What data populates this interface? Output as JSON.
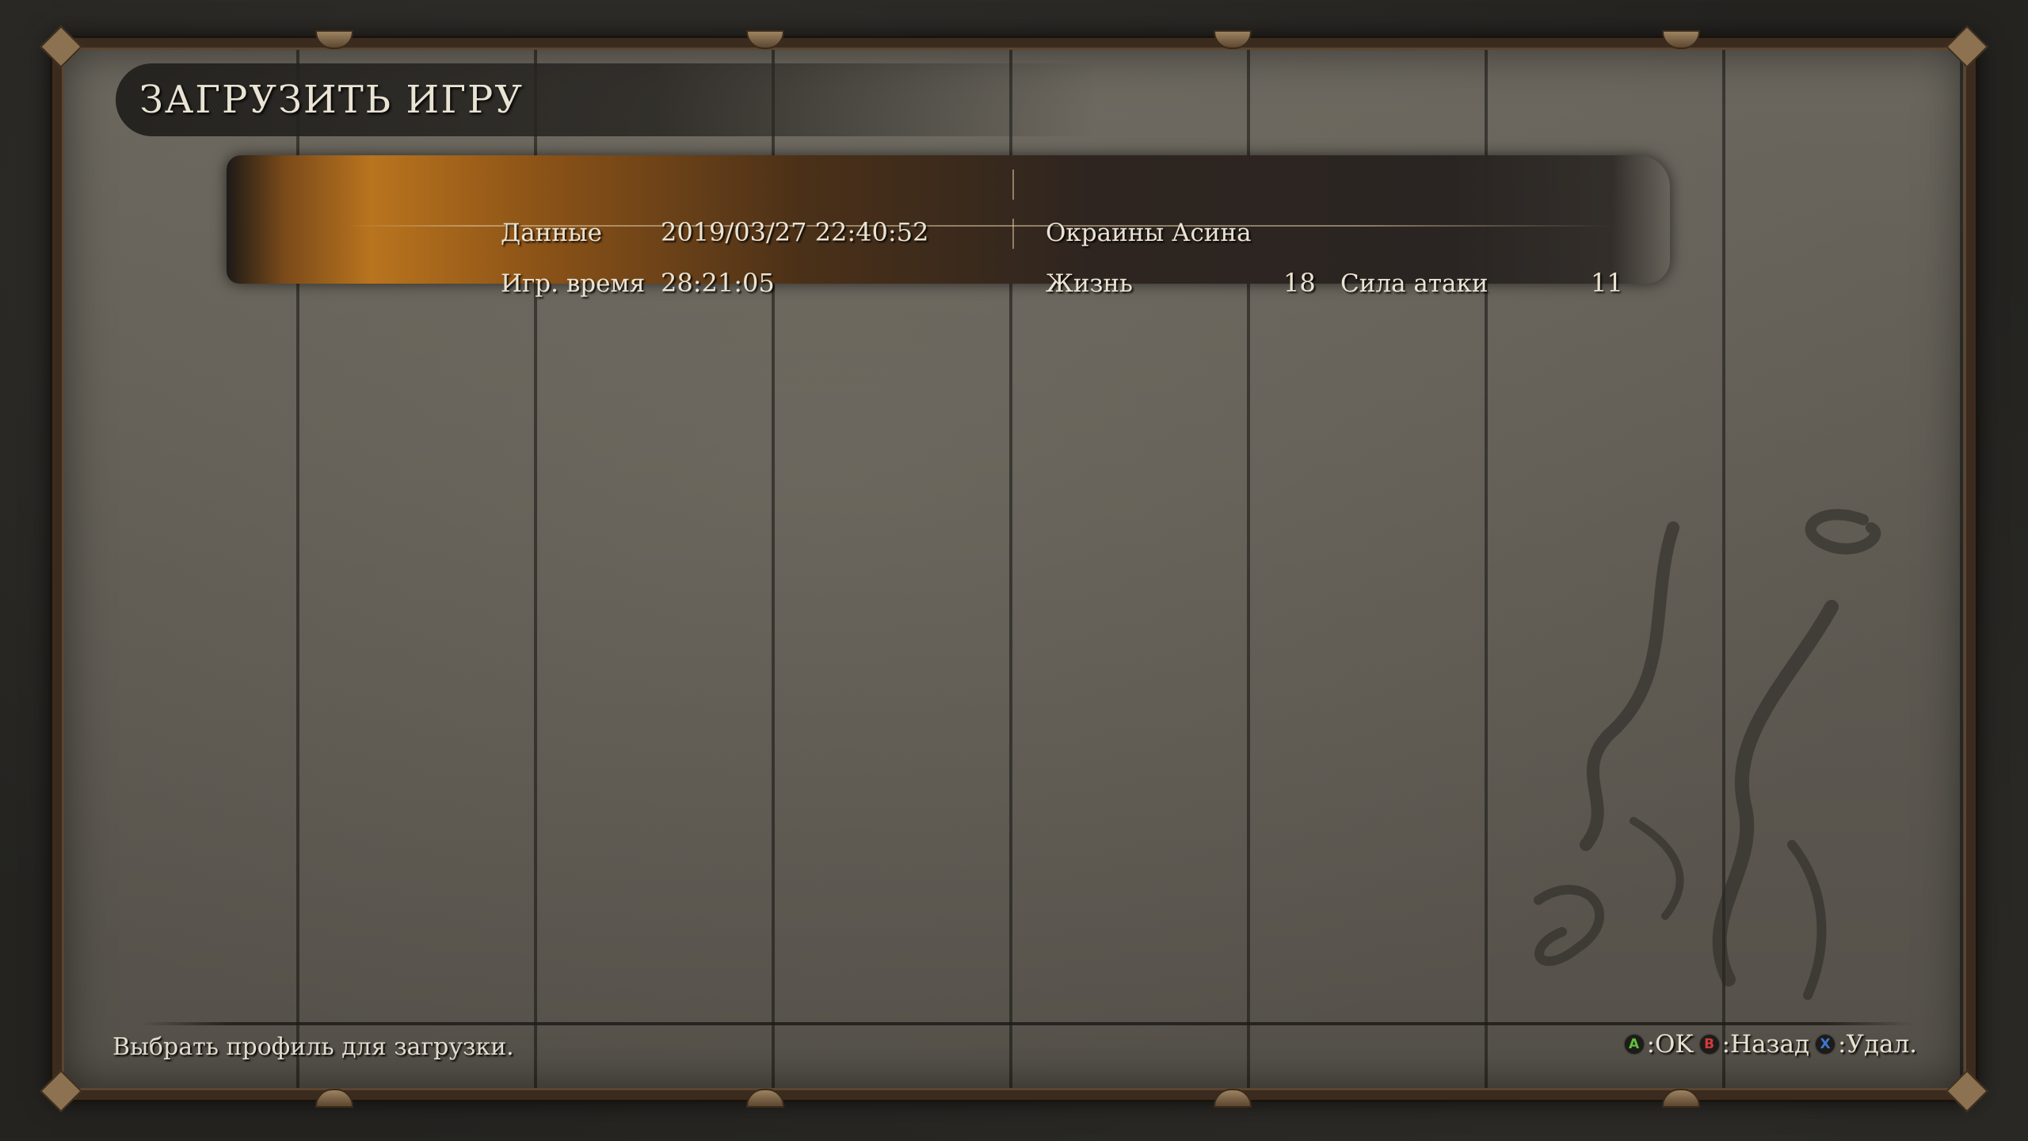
{
  "screen": {
    "title": "ЗАГРУЗИТЬ ИГРУ",
    "hint": "Выбрать профиль для загрузки."
  },
  "save_slots": [
    {
      "data_label": "Данные",
      "date": "2019/03/27 22:40:52",
      "location": "Окраины Асина",
      "time_label": "Игр. время",
      "play_time": "28:21:05",
      "vitality_label": "Жизнь",
      "vitality": "18",
      "attack_label": "Сила атаки",
      "attack": "11"
    }
  ],
  "controls": [
    {
      "glyph": "A",
      "label": ":OK",
      "color": "#5fbf3a",
      "icon": "a-button-icon"
    },
    {
      "glyph": "B",
      "label": ":Назад",
      "color": "#d23a3a",
      "icon": "b-button-icon"
    },
    {
      "glyph": "X",
      "label": ":Удал.",
      "color": "#3a78d2",
      "icon": "x-button-icon"
    }
  ]
}
